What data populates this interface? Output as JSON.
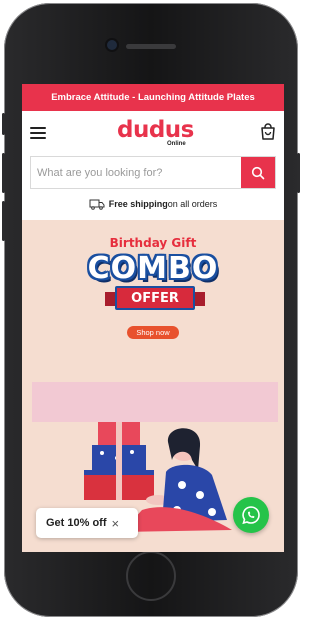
{
  "announcement": {
    "text": "Embrace Attitude - Launching Attitude Plates"
  },
  "header": {
    "logo_text": "dudus",
    "logo_sub": "Online"
  },
  "search": {
    "placeholder": "What are you looking for?"
  },
  "shipping": {
    "bold": "Free shipping",
    "rest": "on all orders"
  },
  "hero": {
    "kicker": "Birthday Gift",
    "headline": "COMBO",
    "ribbon": "OFFER",
    "cta": "Shop now"
  },
  "discount_popup": {
    "label": "Get 10% off",
    "close": "×"
  },
  "colors": {
    "brand": "#e8334c",
    "hero_bg": "#f5ddd0",
    "whatsapp": "#25c349"
  },
  "icons": [
    "menu-icon",
    "cart-icon",
    "search-icon",
    "truck-icon",
    "whatsapp-icon",
    "close-icon"
  ]
}
